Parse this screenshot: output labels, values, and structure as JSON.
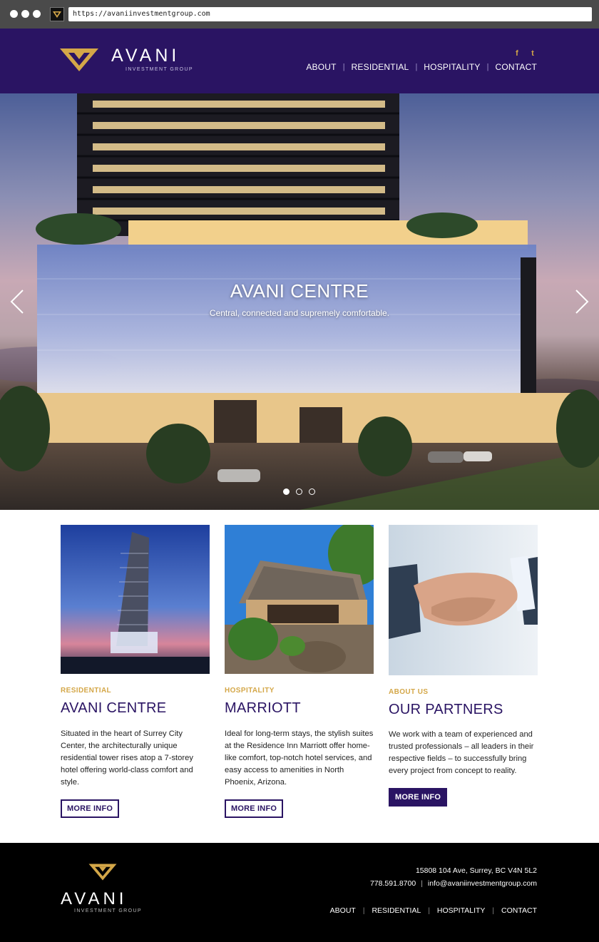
{
  "browser": {
    "url": "https://avaniinvestmentgroup.com"
  },
  "brand": {
    "name": "AVANI",
    "tagline": "INVESTMENT GROUP",
    "colors": {
      "primary": "#2a1463",
      "accent": "#d4a748",
      "footer": "#000000"
    }
  },
  "header": {
    "social": [
      {
        "icon": "facebook-icon",
        "glyph": "f"
      },
      {
        "icon": "twitter-icon",
        "glyph": "t"
      }
    ],
    "nav": [
      "ABOUT",
      "RESIDENTIAL",
      "HOSPITALITY",
      "CONTACT"
    ]
  },
  "hero": {
    "title": "AVANI CENTRE",
    "subtitle": "Central, connected and supremely comfortable.",
    "slide_count": 3,
    "active_slide": 1
  },
  "cards": [
    {
      "kicker": "RESIDENTIAL",
      "title": "AVANI CENTRE",
      "text": "Situated in the heart of Surrey City Center, the architecturally unique residential tower rises atop a 7-storey hotel offering world-class comfort and style.",
      "button": "MORE INFO"
    },
    {
      "kicker": "HOSPITALITY",
      "title": "MARRIOTT",
      "text": "Ideal for long-term stays, the stylish suites at the Residence Inn Marriott offer home-like comfort, top-notch hotel services, and easy access to amenities in North Phoenix, Arizona.",
      "button": "MORE INFO"
    },
    {
      "kicker": "ABOUT US",
      "title": "OUR PARTNERS",
      "text": "We work with a team of experienced and trusted professionals – all leaders in their respective fields – to successfully bring every project from concept to reality.",
      "button": "MORE INFO"
    }
  ],
  "footer": {
    "address": "15808 104 Ave, Surrey, BC V4N 5L2",
    "phone": "778.591.8700",
    "email": "info@avaniinvestmentgroup.com",
    "nav": [
      "ABOUT",
      "RESIDENTIAL",
      "HOSPITALITY",
      "CONTACT"
    ]
  }
}
